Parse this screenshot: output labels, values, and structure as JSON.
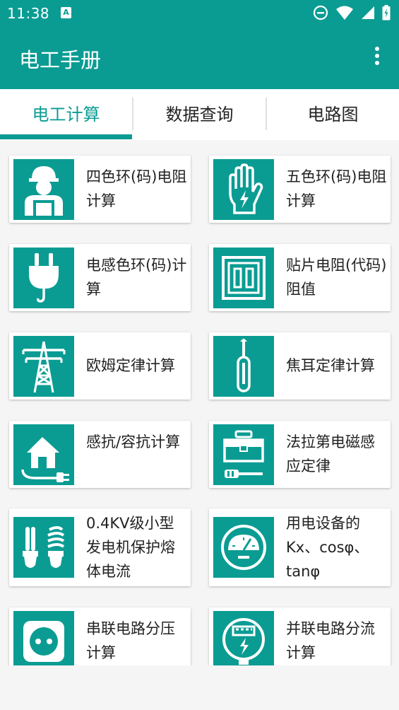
{
  "status": {
    "time": "11:38",
    "badge": "A"
  },
  "app": {
    "title": "电工手册"
  },
  "tabs": [
    {
      "label": "电工计算",
      "active": true
    },
    {
      "label": "数据查询",
      "active": false
    },
    {
      "label": "电路图",
      "active": false
    }
  ],
  "cards": [
    {
      "label": "四色环(码)电阻计算",
      "icon": "worker-icon"
    },
    {
      "label": "五色环(码)电阻计算",
      "icon": "glove-icon"
    },
    {
      "label": "电感色环(码)计算",
      "icon": "plug-icon"
    },
    {
      "label": "贴片电阻(代码)阻值",
      "icon": "switch-icon"
    },
    {
      "label": "欧姆定律计算",
      "icon": "tower-icon"
    },
    {
      "label": "焦耳定律计算",
      "icon": "screwdriver-icon"
    },
    {
      "label": "感抗/容抗计算",
      "icon": "house-plug-icon"
    },
    {
      "label": "法拉第电磁感应定律",
      "icon": "toolbox-icon"
    },
    {
      "label": "0.4KV级小型发电机保护熔体电流",
      "icon": "bulb-icon"
    },
    {
      "label": "用电设备的Kx、cosφ、tanφ",
      "icon": "meter-icon"
    },
    {
      "label": "串联电路分压计算",
      "icon": "socket-icon"
    },
    {
      "label": "并联电路分流计算",
      "icon": "electric-meter-icon"
    }
  ],
  "colors": {
    "primary": "#0a9c93"
  }
}
